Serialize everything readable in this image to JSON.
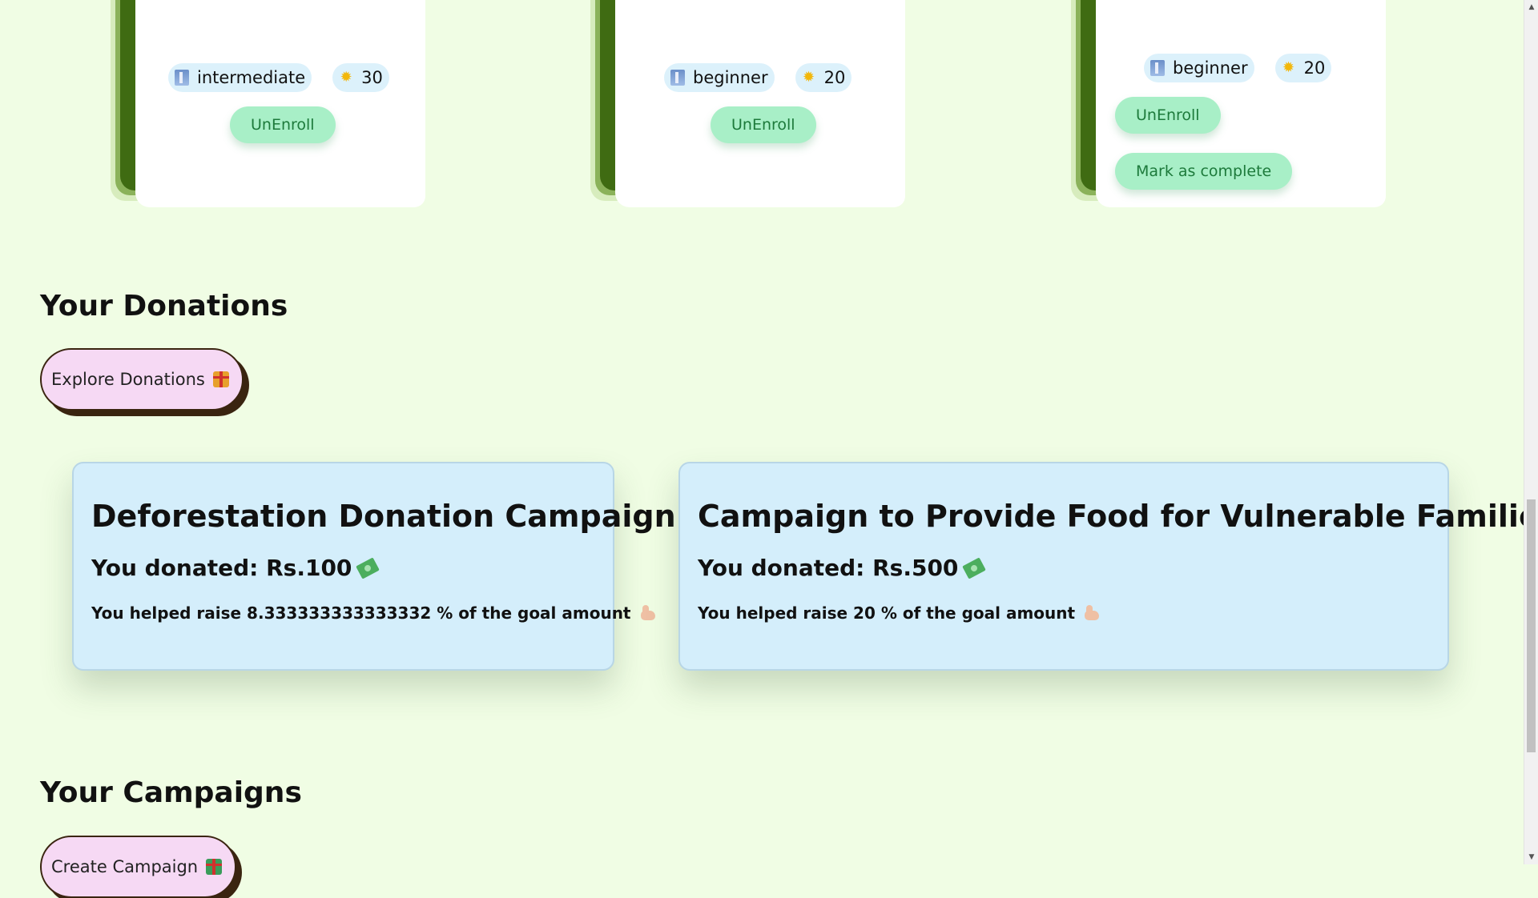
{
  "courses": [
    {
      "level": "intermediate",
      "points": "30",
      "unenroll_label": "UnEnroll"
    },
    {
      "level": "beginner",
      "points": "20",
      "unenroll_label": "UnEnroll"
    },
    {
      "level": "beginner",
      "points": "20",
      "unenroll_label": "UnEnroll",
      "complete_label": "Mark as complete"
    }
  ],
  "icons": {
    "level": "ladder-icon",
    "points": "sun-icon",
    "explore_donations": "gift-icon",
    "donated": "money-icon",
    "helped": "flexed-arm-icon",
    "create_campaign": "chart-icon"
  },
  "donations_section": {
    "title": "Your Donations",
    "explore_label": "Explore Donations"
  },
  "donations": [
    {
      "title": "Deforestation Donation Campaign",
      "donated": "You donated: Rs.100",
      "helped": "You helped raise 8.333333333333332 % of the goal amount"
    },
    {
      "title": "Campaign to Provide Food for Vulnerable Families",
      "donated": "You donated: Rs.500",
      "helped": "You helped raise 20 % of the goal amount"
    }
  ],
  "campaigns_section": {
    "title": "Your Campaigns",
    "create_label": "Create Campaign"
  },
  "colors": {
    "page_background": "#f0fde4",
    "card_stack_dark": "#3f6b12",
    "chip_background": "#dcf1fb",
    "green_button": "#a8efc7",
    "green_button_text": "#1d7a3b",
    "pill_button": "#f6d9f4",
    "donation_card": "#d4eefb"
  }
}
